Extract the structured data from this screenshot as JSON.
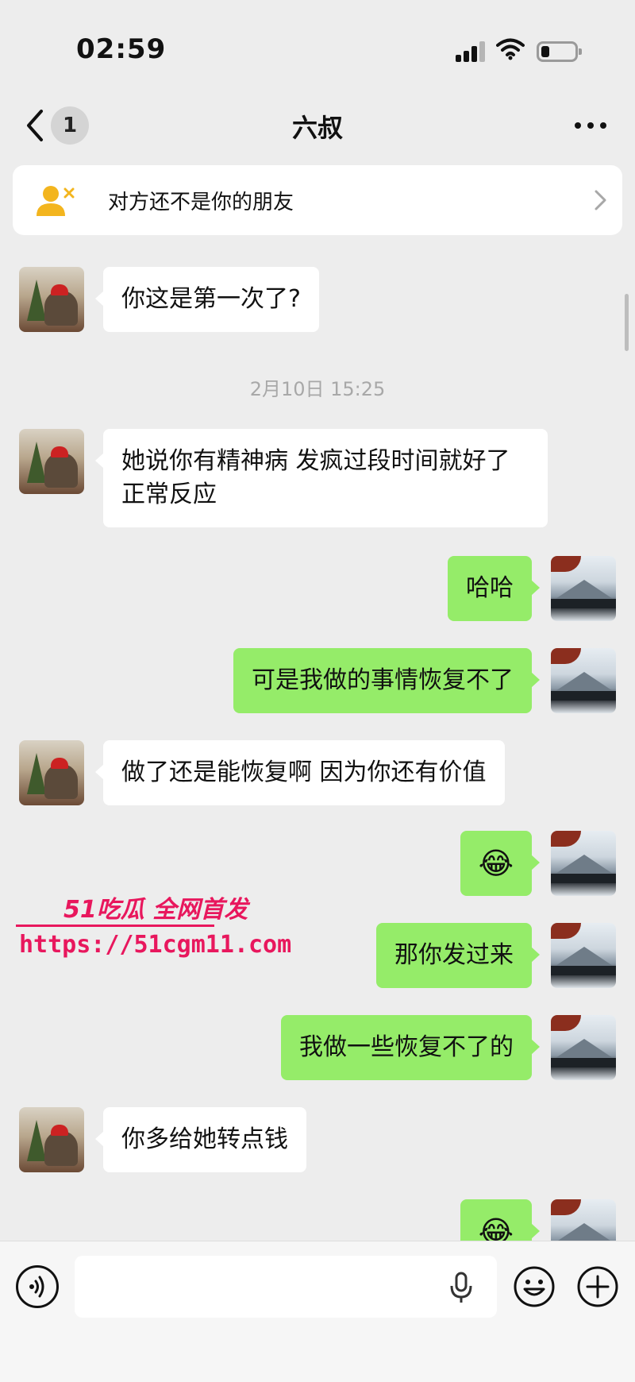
{
  "status_bar": {
    "time": "02:59"
  },
  "nav": {
    "unread_count": "1",
    "title": "六叔"
  },
  "notice": {
    "text": "对方还不是你的朋友"
  },
  "messages": [
    {
      "side": "left",
      "text": "你这是第一次了?"
    },
    {
      "type": "timestamp",
      "text": "2月10日 15:25"
    },
    {
      "side": "left",
      "text": "她说你有精神病 发疯过段时间就好了 正常反应"
    },
    {
      "side": "right",
      "text": "哈哈"
    },
    {
      "side": "right",
      "text": "可是我做的事情恢复不了"
    },
    {
      "side": "left",
      "text": "做了还是能恢复啊 因为你还有价值"
    },
    {
      "side": "right",
      "text": "😂"
    },
    {
      "side": "right",
      "text": "那你发过来"
    },
    {
      "side": "right",
      "text": "我做一些恢复不了的"
    },
    {
      "side": "left",
      "text": "你多给她转点钱"
    },
    {
      "side": "right",
      "text": "😂"
    }
  ],
  "watermark": {
    "line1": "51吃瓜 全网首发",
    "line2": "https://51cgm11.com"
  },
  "input_bar": {
    "value": ""
  },
  "colors": {
    "background": "#ededed",
    "self_bubble": "#95ec69",
    "other_bubble": "#ffffff",
    "watermark": "#e8175d",
    "notice_icon": "#f3b51e"
  }
}
